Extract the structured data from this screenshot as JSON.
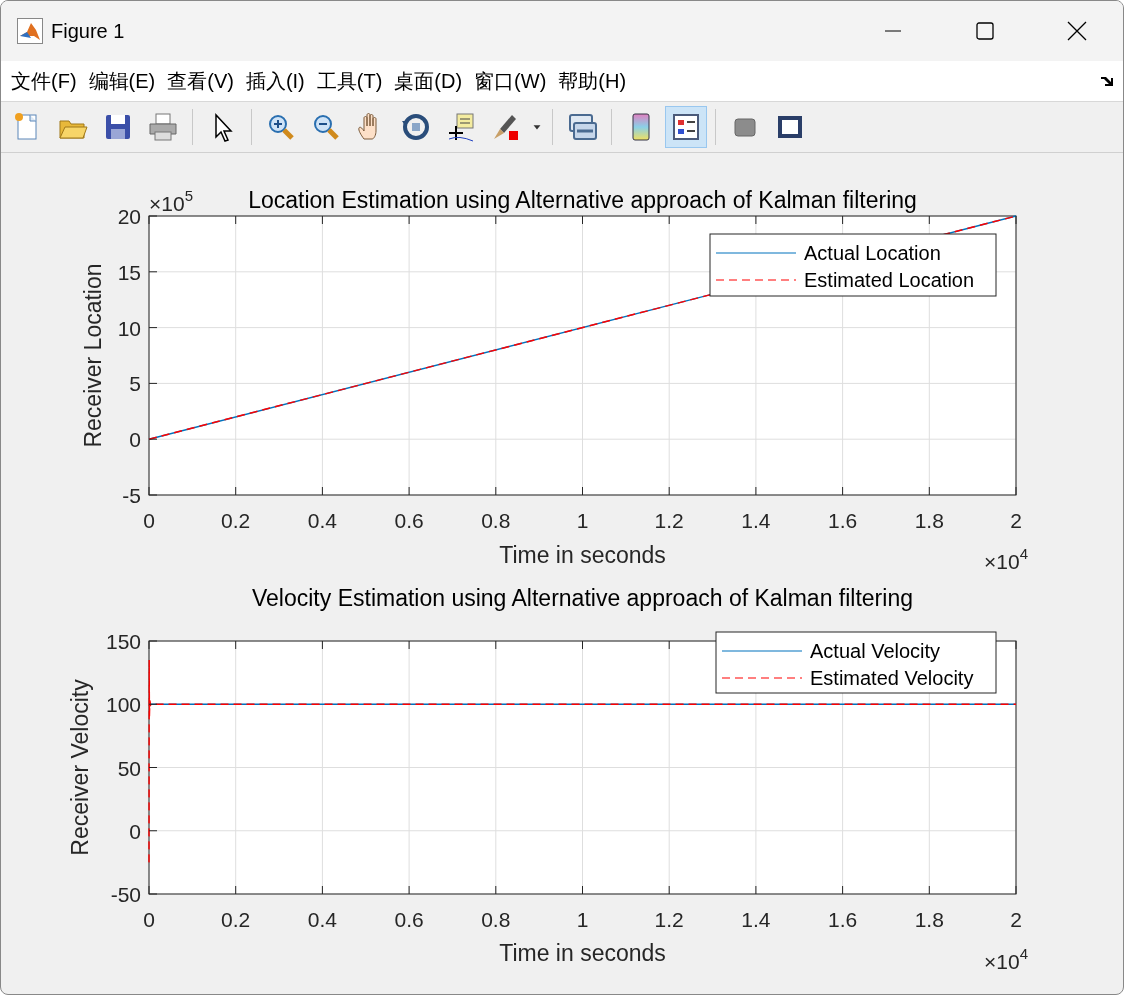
{
  "window": {
    "title": "Figure 1"
  },
  "menu": [
    {
      "label": "文件(F)"
    },
    {
      "label": "编辑(E)"
    },
    {
      "label": "查看(V)"
    },
    {
      "label": "插入(I)"
    },
    {
      "label": "工具(T)"
    },
    {
      "label": "桌面(D)"
    },
    {
      "label": "窗口(W)"
    },
    {
      "label": "帮助(H)"
    }
  ],
  "toolbar": [
    [
      {
        "kind": "new",
        "selected": false
      },
      {
        "kind": "open",
        "selected": false
      },
      {
        "kind": "save",
        "selected": false
      },
      {
        "kind": "print",
        "selected": false
      }
    ],
    [
      {
        "kind": "pointer",
        "selected": false
      }
    ],
    [
      {
        "kind": "zoom-in",
        "selected": false
      },
      {
        "kind": "zoom-out",
        "selected": false
      },
      {
        "kind": "pan",
        "selected": false
      },
      {
        "kind": "rotate",
        "selected": false
      },
      {
        "kind": "data-tip",
        "selected": false
      },
      {
        "kind": "brush",
        "selected": false
      },
      {
        "kind": "caret",
        "selected": false
      }
    ],
    [
      {
        "kind": "link",
        "selected": false
      }
    ],
    [
      {
        "kind": "colorbar",
        "selected": false
      },
      {
        "kind": "legend",
        "selected": true
      }
    ],
    [
      {
        "kind": "hide",
        "selected": false
      },
      {
        "kind": "show",
        "selected": false
      }
    ]
  ],
  "plots": [
    {
      "chart_data": {
        "type": "line",
        "grid": true,
        "legend": true,
        "title": "Location Estimation using Alternative approach of Kalman filtering",
        "xlabel": "Time in seconds",
        "ylabel": "Receiver Location",
        "xlim": [
          0,
          2
        ],
        "ylim": [
          -5,
          20
        ],
        "xticks": [
          0,
          0.2,
          0.4,
          0.6,
          0.8,
          1,
          1.2,
          1.4,
          1.6,
          1.8,
          2
        ],
        "yticks": [
          -5,
          0,
          5,
          10,
          15,
          20
        ],
        "series": [
          {
            "name": "Actual Location",
            "color": "#0072bd",
            "line_style": "solid",
            "x": [
              0,
              2
            ],
            "values": [
              0,
              20
            ]
          },
          {
            "name": "Estimated Location",
            "color": "#ff0000",
            "line_style": "dashed",
            "x": [
              0,
              2
            ],
            "values": [
              0,
              20
            ]
          }
        ]
      },
      "x_multiplier": "×10$^{4}$",
      "y_multiplier": "×10$^{5}$"
    },
    {
      "chart_data": {
        "type": "line",
        "grid": true,
        "legend": true,
        "title": "Velocity Estimation using Alternative approach of Kalman filtering",
        "xlabel": "Time in seconds",
        "ylabel": "Receiver Velocity",
        "xlim": [
          0,
          2
        ],
        "ylim": [
          -50,
          150
        ],
        "xticks": [
          0,
          0.2,
          0.4,
          0.6,
          0.8,
          1,
          1.2,
          1.4,
          1.6,
          1.8,
          2
        ],
        "yticks": [
          -50,
          0,
          50,
          100,
          150
        ],
        "series": [
          {
            "name": "Actual Velocity",
            "color": "#0072bd",
            "line_style": "solid",
            "x": [
              0,
              2
            ],
            "values": [
              100,
              100
            ]
          },
          {
            "name": "Estimated Velocity",
            "color": "#ff0000",
            "line_style": "dashed",
            "x": [
              0,
              0.0005,
              0.001,
              0.002,
              0.004,
              0.01,
              2
            ],
            "values": [
              -25,
              135,
              90,
              103,
              99,
              100,
              100
            ]
          }
        ]
      },
      "x_multiplier": "×10$^{4}$"
    }
  ]
}
